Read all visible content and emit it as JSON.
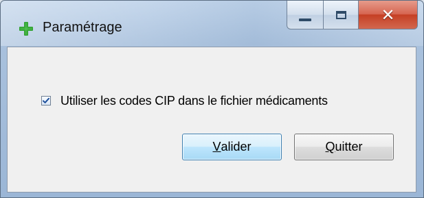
{
  "window": {
    "title": "Paramétrage",
    "controls": {
      "minimize": "minimize-icon",
      "maximize": "maximize-icon",
      "close": "close-icon"
    }
  },
  "content": {
    "checkbox": {
      "label": "Utiliser les codes CIP dans le fichier médicaments",
      "checked": true
    },
    "buttons": {
      "validate": {
        "accesskey": "V",
        "rest": "alider"
      },
      "quit": {
        "accesskey": "Q",
        "rest": "uitter"
      }
    }
  },
  "colors": {
    "accent_green": "#2fa12f",
    "close_red": "#c53f24",
    "primary_button_border": "#3c7fb1"
  }
}
